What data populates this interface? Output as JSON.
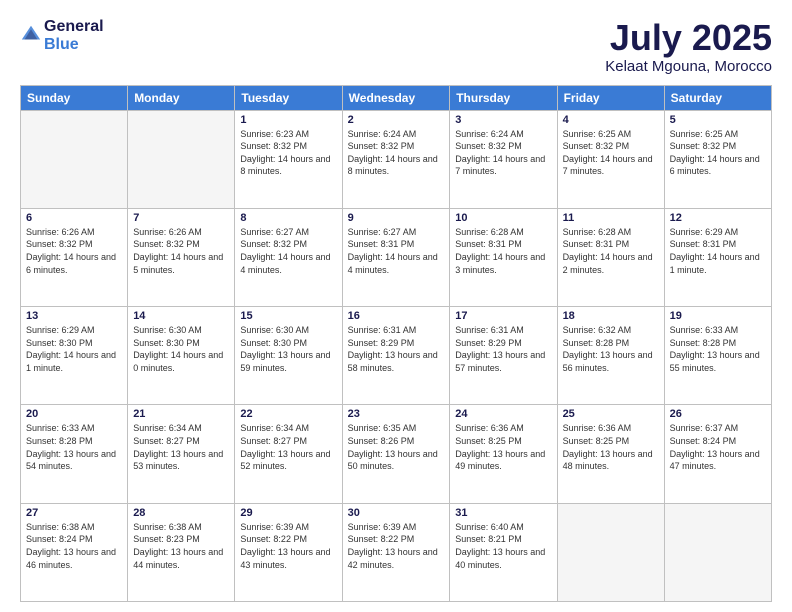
{
  "header": {
    "logo_general": "General",
    "logo_blue": "Blue",
    "month_title": "July 2025",
    "location": "Kelaat Mgouna, Morocco"
  },
  "weekdays": [
    "Sunday",
    "Monday",
    "Tuesday",
    "Wednesday",
    "Thursday",
    "Friday",
    "Saturday"
  ],
  "weeks": [
    [
      {
        "day": "",
        "info": ""
      },
      {
        "day": "",
        "info": ""
      },
      {
        "day": "1",
        "info": "Sunrise: 6:23 AM\nSunset: 8:32 PM\nDaylight: 14 hours and 8 minutes."
      },
      {
        "day": "2",
        "info": "Sunrise: 6:24 AM\nSunset: 8:32 PM\nDaylight: 14 hours and 8 minutes."
      },
      {
        "day": "3",
        "info": "Sunrise: 6:24 AM\nSunset: 8:32 PM\nDaylight: 14 hours and 7 minutes."
      },
      {
        "day": "4",
        "info": "Sunrise: 6:25 AM\nSunset: 8:32 PM\nDaylight: 14 hours and 7 minutes."
      },
      {
        "day": "5",
        "info": "Sunrise: 6:25 AM\nSunset: 8:32 PM\nDaylight: 14 hours and 6 minutes."
      }
    ],
    [
      {
        "day": "6",
        "info": "Sunrise: 6:26 AM\nSunset: 8:32 PM\nDaylight: 14 hours and 6 minutes."
      },
      {
        "day": "7",
        "info": "Sunrise: 6:26 AM\nSunset: 8:32 PM\nDaylight: 14 hours and 5 minutes."
      },
      {
        "day": "8",
        "info": "Sunrise: 6:27 AM\nSunset: 8:32 PM\nDaylight: 14 hours and 4 minutes."
      },
      {
        "day": "9",
        "info": "Sunrise: 6:27 AM\nSunset: 8:31 PM\nDaylight: 14 hours and 4 minutes."
      },
      {
        "day": "10",
        "info": "Sunrise: 6:28 AM\nSunset: 8:31 PM\nDaylight: 14 hours and 3 minutes."
      },
      {
        "day": "11",
        "info": "Sunrise: 6:28 AM\nSunset: 8:31 PM\nDaylight: 14 hours and 2 minutes."
      },
      {
        "day": "12",
        "info": "Sunrise: 6:29 AM\nSunset: 8:31 PM\nDaylight: 14 hours and 1 minute."
      }
    ],
    [
      {
        "day": "13",
        "info": "Sunrise: 6:29 AM\nSunset: 8:30 PM\nDaylight: 14 hours and 1 minute."
      },
      {
        "day": "14",
        "info": "Sunrise: 6:30 AM\nSunset: 8:30 PM\nDaylight: 14 hours and 0 minutes."
      },
      {
        "day": "15",
        "info": "Sunrise: 6:30 AM\nSunset: 8:30 PM\nDaylight: 13 hours and 59 minutes."
      },
      {
        "day": "16",
        "info": "Sunrise: 6:31 AM\nSunset: 8:29 PM\nDaylight: 13 hours and 58 minutes."
      },
      {
        "day": "17",
        "info": "Sunrise: 6:31 AM\nSunset: 8:29 PM\nDaylight: 13 hours and 57 minutes."
      },
      {
        "day": "18",
        "info": "Sunrise: 6:32 AM\nSunset: 8:28 PM\nDaylight: 13 hours and 56 minutes."
      },
      {
        "day": "19",
        "info": "Sunrise: 6:33 AM\nSunset: 8:28 PM\nDaylight: 13 hours and 55 minutes."
      }
    ],
    [
      {
        "day": "20",
        "info": "Sunrise: 6:33 AM\nSunset: 8:28 PM\nDaylight: 13 hours and 54 minutes."
      },
      {
        "day": "21",
        "info": "Sunrise: 6:34 AM\nSunset: 8:27 PM\nDaylight: 13 hours and 53 minutes."
      },
      {
        "day": "22",
        "info": "Sunrise: 6:34 AM\nSunset: 8:27 PM\nDaylight: 13 hours and 52 minutes."
      },
      {
        "day": "23",
        "info": "Sunrise: 6:35 AM\nSunset: 8:26 PM\nDaylight: 13 hours and 50 minutes."
      },
      {
        "day": "24",
        "info": "Sunrise: 6:36 AM\nSunset: 8:25 PM\nDaylight: 13 hours and 49 minutes."
      },
      {
        "day": "25",
        "info": "Sunrise: 6:36 AM\nSunset: 8:25 PM\nDaylight: 13 hours and 48 minutes."
      },
      {
        "day": "26",
        "info": "Sunrise: 6:37 AM\nSunset: 8:24 PM\nDaylight: 13 hours and 47 minutes."
      }
    ],
    [
      {
        "day": "27",
        "info": "Sunrise: 6:38 AM\nSunset: 8:24 PM\nDaylight: 13 hours and 46 minutes."
      },
      {
        "day": "28",
        "info": "Sunrise: 6:38 AM\nSunset: 8:23 PM\nDaylight: 13 hours and 44 minutes."
      },
      {
        "day": "29",
        "info": "Sunrise: 6:39 AM\nSunset: 8:22 PM\nDaylight: 13 hours and 43 minutes."
      },
      {
        "day": "30",
        "info": "Sunrise: 6:39 AM\nSunset: 8:22 PM\nDaylight: 13 hours and 42 minutes."
      },
      {
        "day": "31",
        "info": "Sunrise: 6:40 AM\nSunset: 8:21 PM\nDaylight: 13 hours and 40 minutes."
      },
      {
        "day": "",
        "info": ""
      },
      {
        "day": "",
        "info": ""
      }
    ]
  ]
}
